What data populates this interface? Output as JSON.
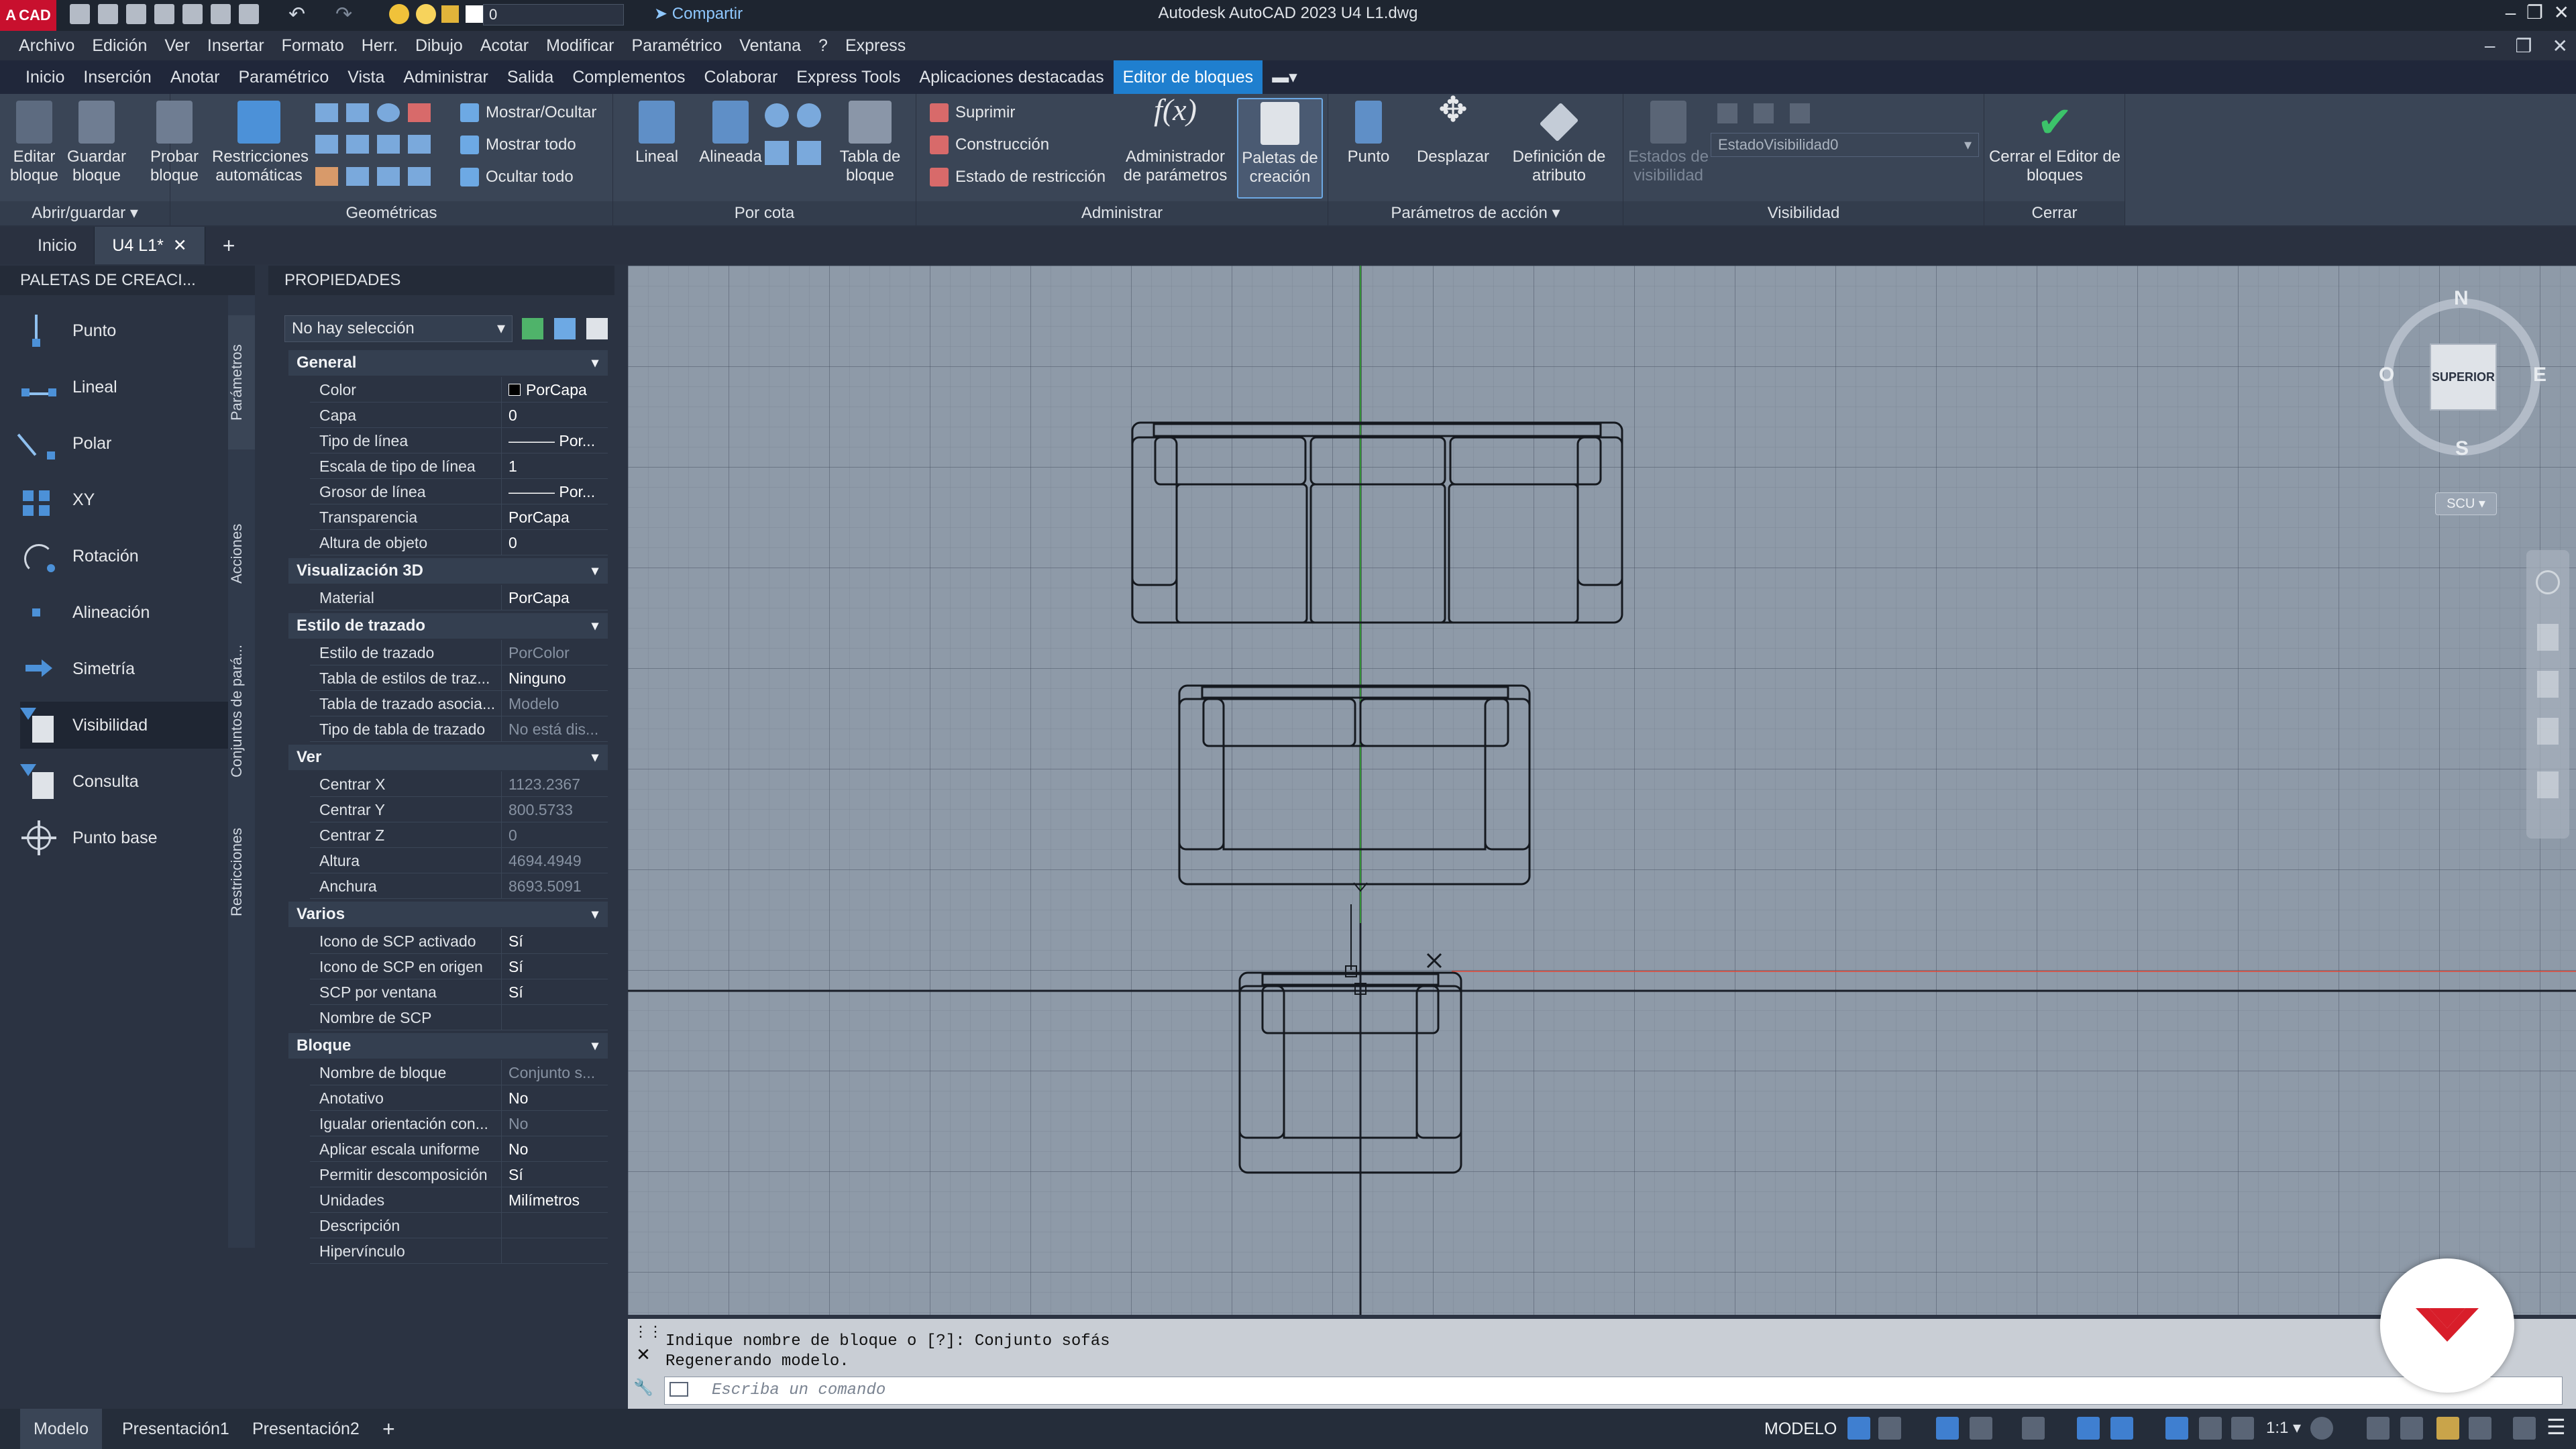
{
  "titlebar": {
    "logo_text": "CAD",
    "layer_value": "0",
    "share": "Compartir",
    "app_title": "Autodesk AutoCAD 2023    U4 L1.dwg"
  },
  "menubar": [
    "Archivo",
    "Edición",
    "Ver",
    "Insertar",
    "Formato",
    "Herr.",
    "Dibujo",
    "Acotar",
    "Modificar",
    "Paramétrico",
    "Ventana",
    "?",
    "Express"
  ],
  "ribbon_tabs": [
    "Inicio",
    "Inserción",
    "Anotar",
    "Paramétrico",
    "Vista",
    "Administrar",
    "Salida",
    "Complementos",
    "Colaborar",
    "Express Tools",
    "Aplicaciones destacadas",
    "Editor de bloques"
  ],
  "ribbon": {
    "abrir": {
      "title": "Abrir/guardar",
      "editar": "Editar bloque",
      "guardar": "Guardar bloque",
      "probar": "Probar bloque"
    },
    "geometricas": {
      "title": "Geométricas",
      "restricciones": "Restricciones automáticas",
      "mostrar_ocultar": "Mostrar/Ocultar",
      "mostrar_todo": "Mostrar todo",
      "ocultar_todo": "Ocultar todo"
    },
    "por_cota": {
      "title": "Por cota",
      "lineal": "Lineal",
      "alineada": "Alineada",
      "tabla": "Tabla de bloque"
    },
    "administrar": {
      "title": "Administrar",
      "suprimir": "Suprimir",
      "construccion": "Construcción",
      "estado": "Estado de restricción",
      "admin_param": "Administrador de parámetros",
      "paletas": "Paletas de creación"
    },
    "accion": {
      "title": "Parámetros de acción",
      "punto": "Punto",
      "desplazar": "Desplazar",
      "definicion": "Definición de atributo"
    },
    "visibilidad": {
      "title": "Visibilidad",
      "estados": "Estados de visibilidad",
      "combo": "EstadoVisibilidad0"
    },
    "cerrar": {
      "title": "Cerrar",
      "cerrar_editor": "Cerrar el Editor de bloques"
    }
  },
  "doc_tabs": [
    "Inicio",
    "U4 L1*"
  ],
  "palettes": {
    "title": "PALETAS DE CREACI...",
    "items": [
      "Punto",
      "Lineal",
      "Polar",
      "XY",
      "Rotación",
      "Alineación",
      "Simetría",
      "Visibilidad",
      "Consulta",
      "Punto base"
    ],
    "vtabs": [
      "Parámetros",
      "Acciones",
      "Conjuntos de pará...",
      "Restricciones"
    ]
  },
  "properties": {
    "title": "PROPIEDADES",
    "selection": "No hay selección",
    "sections": [
      {
        "name": "General",
        "rows": [
          [
            "Color",
            "PorCapa"
          ],
          [
            "Capa",
            "0"
          ],
          [
            "Tipo de línea",
            "——— Por..."
          ],
          [
            "Escala de tipo de línea",
            "1"
          ],
          [
            "Grosor de línea",
            "——— Por..."
          ],
          [
            "Transparencia",
            "PorCapa"
          ],
          [
            "Altura de objeto",
            "0"
          ]
        ]
      },
      {
        "name": "Visualización 3D",
        "rows": [
          [
            "Material",
            "PorCapa"
          ]
        ]
      },
      {
        "name": "Estilo de trazado",
        "rows": [
          [
            "Estilo de trazado",
            "PorColor"
          ],
          [
            "Tabla de estilos de traz...",
            "Ninguno"
          ],
          [
            "Tabla de trazado asocia...",
            "Modelo"
          ],
          [
            "Tipo de tabla de trazado",
            "No está dis..."
          ]
        ]
      },
      {
        "name": "Ver",
        "rows": [
          [
            "Centrar X",
            "1123.2367"
          ],
          [
            "Centrar Y",
            "800.5733"
          ],
          [
            "Centrar Z",
            "0"
          ],
          [
            "Altura",
            "4694.4949"
          ],
          [
            "Anchura",
            "8693.5091"
          ]
        ]
      },
      {
        "name": "Varios",
        "rows": [
          [
            "Icono de SCP activado",
            "Sí"
          ],
          [
            "Icono de SCP en origen",
            "Sí"
          ],
          [
            "SCP por ventana",
            "Sí"
          ],
          [
            "Nombre de SCP",
            ""
          ]
        ]
      },
      {
        "name": "Bloque",
        "rows": [
          [
            "Nombre de bloque",
            "Conjunto s..."
          ],
          [
            "Anotativo",
            "No"
          ],
          [
            "Igualar orientación con...",
            "No"
          ],
          [
            "Aplicar escala uniforme",
            "No"
          ],
          [
            "Permitir descomposición",
            "Sí"
          ],
          [
            "Unidades",
            "Milímetros"
          ],
          [
            "Descripción",
            ""
          ],
          [
            "Hipervínculo",
            ""
          ]
        ]
      }
    ]
  },
  "viewcube": {
    "face": "SUPERIOR",
    "n": "N",
    "s": "S",
    "e": "E",
    "o": "O",
    "scu": "SCU"
  },
  "command": {
    "line1": "Indique nombre de bloque o [?]: Conjunto sofás",
    "line2": "Regenerando modelo.",
    "placeholder": "Escriba un comando"
  },
  "status": {
    "layouts": [
      "Modelo",
      "Presentación1",
      "Presentación2"
    ],
    "model": "MODELO",
    "scale": "1:1"
  }
}
